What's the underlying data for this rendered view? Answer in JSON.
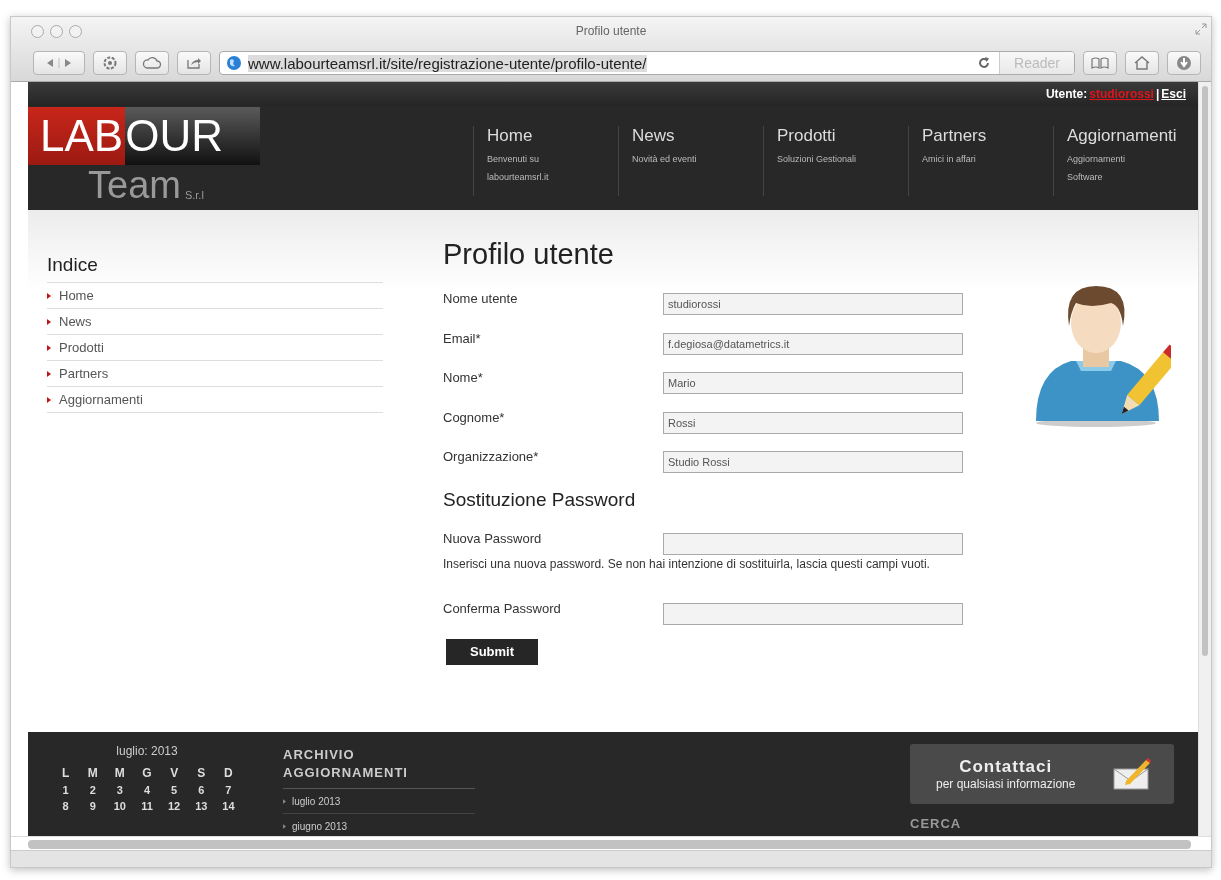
{
  "window": {
    "title": "Profilo utente"
  },
  "toolbar": {
    "url": "www.labourteamsrl.it/site/registrazione-utente/profilo-utente/",
    "reader": "Reader"
  },
  "user_bar": {
    "label": "Utente:",
    "username": "studiorossi",
    "separator": "|",
    "logout": "Esci"
  },
  "logo": {
    "red_part": "LAB",
    "dark_part": "OUR",
    "second_line": "Team",
    "suffix": "S.r.l"
  },
  "nav": [
    {
      "title": "Home",
      "subtitle": "Benvenuti su labourteamsrl.it"
    },
    {
      "title": "News",
      "subtitle": "Novità ed eventi"
    },
    {
      "title": "Prodotti",
      "subtitle": "Soluzioni Gestionali"
    },
    {
      "title": "Partners",
      "subtitle": "Amici in affari"
    },
    {
      "title": "Aggiornamenti",
      "subtitle": "Aggiornamenti Software"
    }
  ],
  "sidebar": {
    "title": "Indice",
    "items": [
      "Home",
      "News",
      "Prodotti",
      "Partners",
      "Aggiornamenti"
    ]
  },
  "form": {
    "title": "Profilo utente",
    "fields": [
      {
        "label": "Nome utente",
        "value": "studiorossi"
      },
      {
        "label": "Email*",
        "value": "f.degiosa@datametrics.it"
      },
      {
        "label": "Nome*",
        "value": "Mario"
      },
      {
        "label": "Cognome*",
        "value": "Rossi"
      },
      {
        "label": "Organizzazione*",
        "value": "Studio Rossi"
      }
    ],
    "password_title": "Sostituzione Password",
    "new_password": {
      "label": "Nuova Password",
      "hint": "Inserisci una nuova password. Se non hai intenzione di sostituirla, lascia questi campi vuoti."
    },
    "confirm_password": {
      "label": "Conferma Password"
    },
    "submit": "Submit"
  },
  "footer": {
    "calendar": {
      "title": "luglio: 2013",
      "weekdays": [
        "L",
        "M",
        "M",
        "G",
        "V",
        "S",
        "D"
      ],
      "weeks": [
        [
          "1",
          "2",
          "3",
          "4",
          "5",
          "6",
          "7"
        ],
        [
          "8",
          "9",
          "10",
          "11",
          "12",
          "13",
          "14"
        ]
      ]
    },
    "archive": {
      "title": "ARCHIVIO AGGIORNAMENTI",
      "items": [
        "luglio 2013",
        "giugno 2013"
      ]
    },
    "contact": {
      "title": "Contattaci",
      "subtitle": "per qualsiasi informazione"
    },
    "search_title": "CERCA"
  }
}
